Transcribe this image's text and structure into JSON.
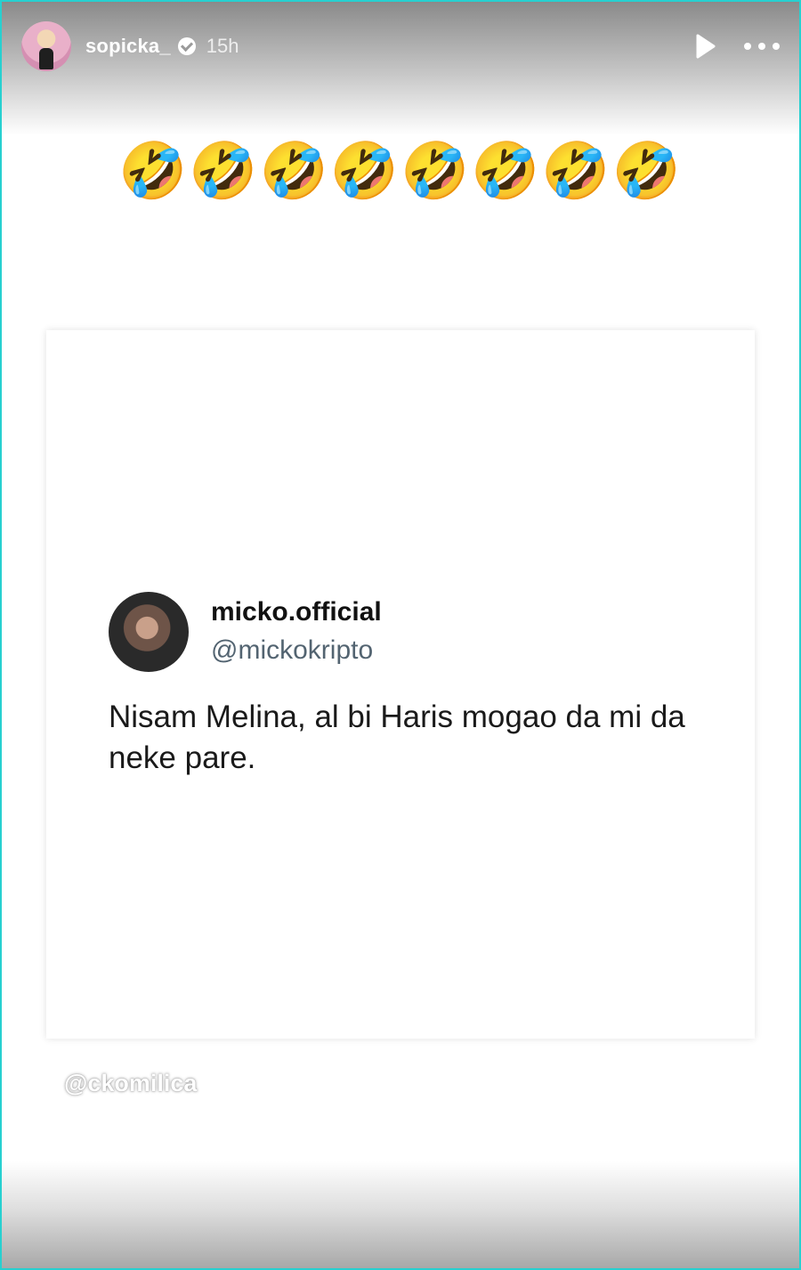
{
  "story": {
    "username": "sopicka_",
    "timestamp": "15h",
    "emoji_caption": "🤣🤣🤣🤣🤣🤣🤣🤣",
    "watermark": "@ckomilica"
  },
  "tweet": {
    "display_name": "micko.official",
    "handle": "@mickokripto",
    "text": "Nisam Melina, al bi Haris mogao da mi da neke pare."
  },
  "icons": {
    "verified": "verified-badge-icon",
    "play": "play-icon",
    "more": "more-options-icon"
  },
  "colors": {
    "frame_border": "#27d0d0",
    "handle_gray": "#536471"
  }
}
